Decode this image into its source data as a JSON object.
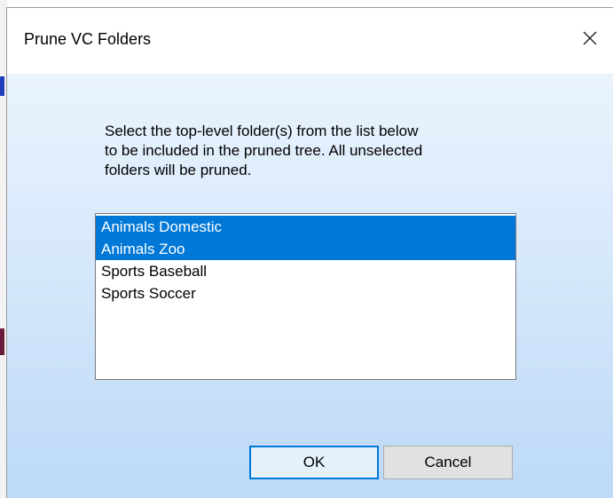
{
  "dialog": {
    "title": "Prune VC Folders",
    "close_icon": "close-icon",
    "instructions": [
      "Select the top-level folder(s) from the list below",
      "to be included in the pruned tree. All unselected",
      "folders will be pruned."
    ],
    "folders": [
      {
        "label": "Animals Domestic",
        "selected": true
      },
      {
        "label": "Animals Zoo",
        "selected": true
      },
      {
        "label": "Sports Baseball",
        "selected": false
      },
      {
        "label": "Sports Soccer",
        "selected": false
      }
    ],
    "ok_label": "OK",
    "cancel_label": "Cancel"
  },
  "colors": {
    "selection": "#0078d7",
    "default_button_border": "#0078d7",
    "client_gradient_top": "#eaf3fd",
    "client_gradient_bottom": "#bcd9f7"
  }
}
